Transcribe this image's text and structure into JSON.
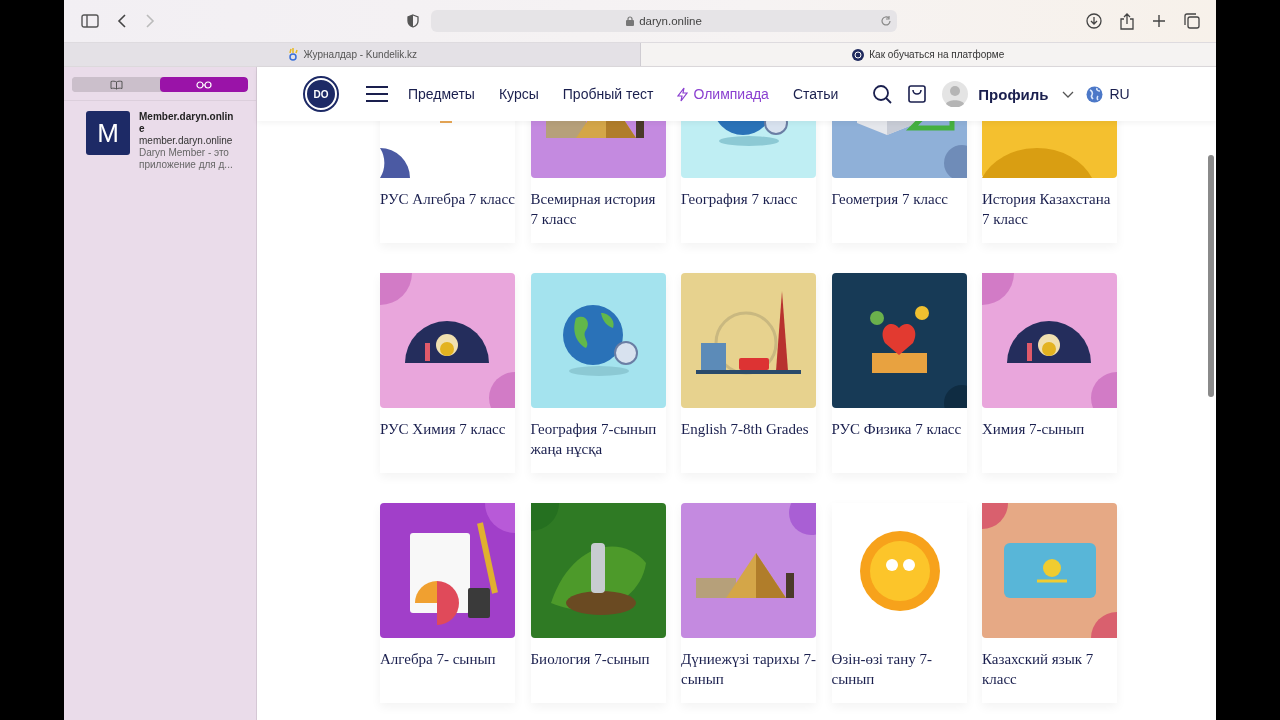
{
  "browser": {
    "url": "daryn.online",
    "tabs": [
      {
        "title": "Журналдар - Kundelik.kz",
        "selected": false
      },
      {
        "title": "Как обучаться на платформе",
        "selected": true
      }
    ]
  },
  "sidebar": {
    "modes": [
      {
        "kind": "bookmarks",
        "selected": false
      },
      {
        "kind": "reading_list",
        "selected": true
      }
    ],
    "items": [
      {
        "initial": "M",
        "title": "Member.daryn.online",
        "url": "member.daryn.online",
        "description": "Daryn Member - это приложение для д..."
      }
    ]
  },
  "header": {
    "logo": "DO",
    "nav": [
      {
        "label": "Предметы",
        "highlighted": false
      },
      {
        "label": "Курсы",
        "highlighted": false
      },
      {
        "label": "Пробный тест",
        "highlighted": false
      },
      {
        "label": "Олимпиада",
        "highlighted": true
      },
      {
        "label": "Статьи",
        "highlighted": false
      }
    ],
    "profile": "Профиль",
    "language": "RU"
  },
  "courses": [
    {
      "title": "РУС Алгебра 7 класс"
    },
    {
      "title": "Всемирная история 7 класс"
    },
    {
      "title": "География 7 класс"
    },
    {
      "title": "Геометрия 7 класс"
    },
    {
      "title": "История Казахстана 7 класс"
    },
    {
      "title": "РУС Химия 7 класс"
    },
    {
      "title": "География 7-сынып жаңа нұсқа"
    },
    {
      "title": "English 7-8th Grades"
    },
    {
      "title": "РУС Физика 7 класс"
    },
    {
      "title": "Химия 7-сынып"
    },
    {
      "title": "Алгебра 7- сынып"
    },
    {
      "title": "Биология 7-сынып"
    },
    {
      "title": "Дүниежүзі тарихы 7-сынып"
    },
    {
      "title": "Өзін-өзі тану 7-сынып"
    },
    {
      "title": "Казахский язык 7 класс"
    }
  ]
}
